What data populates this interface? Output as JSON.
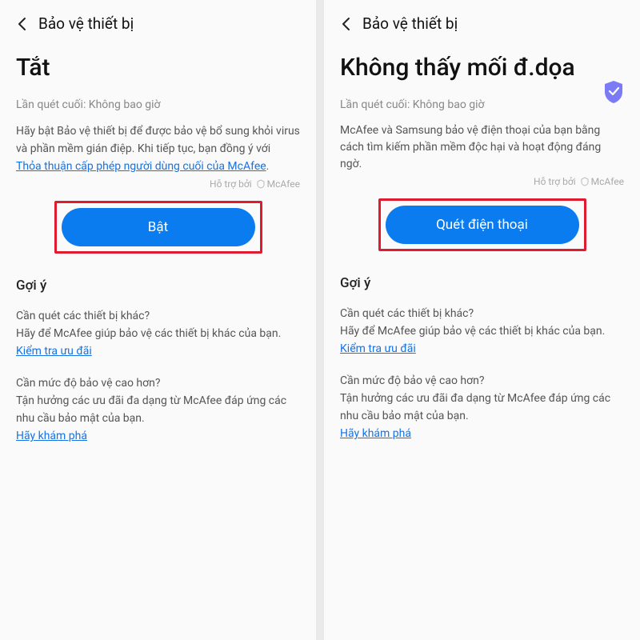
{
  "left": {
    "header": {
      "title": "Bảo vệ thiết bị"
    },
    "title": "Tắt",
    "last_scan": "Lần quét cuối: Không bao giờ",
    "desc": "Hãy bật Bảo vệ thiết bị để được bảo vệ bổ sung khỏi virus và phần mềm gián điệp. Khi tiếp tục, bạn đồng ý với",
    "eula_link": "Thỏa thuận cấp phép người dùng cuối của McAfee",
    "sponsor": "Hỗ trợ bởi",
    "sponsor_brand": "McAfee",
    "button": "Bật",
    "tips_title": "Gợi ý",
    "tip1_q": "Cần quét các thiết bị khác?",
    "tip1_desc": "Hãy để McAfee giúp bảo vệ các thiết bị khác của bạn.",
    "tip1_link": "Kiểm tra ưu đãi",
    "tip2_q": "Cần mức độ bảo vệ cao hơn?",
    "tip2_desc": "Tận hưởng các ưu đãi đa dạng từ McAfee đáp ứng các nhu cầu bảo mật của bạn.",
    "tip2_link": "Hãy khám phá"
  },
  "right": {
    "header": {
      "title": "Bảo vệ thiết bị"
    },
    "title": "Không thấy mối đ.dọa",
    "last_scan": "Lần quét cuối: Không bao giờ",
    "desc": "McAfee và Samsung bảo vệ điện thoại của bạn bằng cách tìm kiếm phần mềm độc hại và hoạt động đáng ngờ.",
    "sponsor": "Hỗ trợ bởi",
    "sponsor_brand": "McAfee",
    "button": "Quét điện thoại",
    "tips_title": "Gợi ý",
    "tip1_q": "Cần quét các thiết bị khác?",
    "tip1_desc": "Hãy để McAfee giúp bảo vệ các thiết bị khác của bạn.",
    "tip1_link": "Kiểm tra ưu đãi",
    "tip2_q": "Cần mức độ bảo vệ cao hơn?",
    "tip2_desc": "Tận hưởng các ưu đãi đa dạng từ McAfee đáp ứng các nhu cầu bảo mật của bạn.",
    "tip2_link": "Hãy khám phá"
  }
}
